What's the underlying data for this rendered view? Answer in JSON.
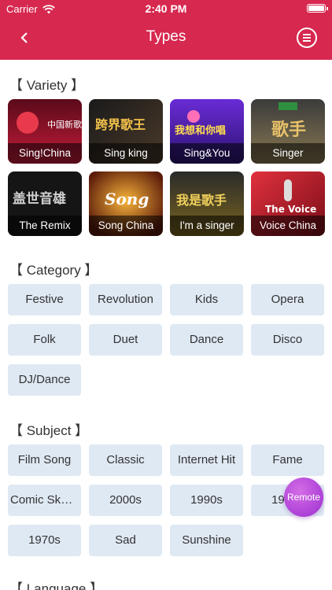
{
  "status": {
    "carrier": "Carrier",
    "time": "2:40 PM"
  },
  "nav": {
    "title": "Types"
  },
  "variety": {
    "title": "【 Variety 】",
    "items": [
      {
        "label": "Sing!China",
        "art": "中国新歌声"
      },
      {
        "label": "Sing king",
        "art": "跨界歌王"
      },
      {
        "label": "Sing&You",
        "art": "我想和你唱"
      },
      {
        "label": "Singer",
        "art": "歌手"
      },
      {
        "label": "The Remix",
        "art": "盖世音雄"
      },
      {
        "label": "Song China",
        "art": "Song"
      },
      {
        "label": "I'm a singer",
        "art": "我是歌手"
      },
      {
        "label": "Voice China",
        "art": "The Voice"
      }
    ]
  },
  "category": {
    "title": "【 Category 】",
    "items": [
      "Festive",
      "Revolution",
      "Kids",
      "Opera",
      "Folk",
      "Duet",
      "Dance",
      "Disco",
      "DJ/Dance"
    ]
  },
  "subject": {
    "title": "【 Subject 】",
    "items": [
      "Film Song",
      "Classic",
      "Internet Hit",
      "Fame",
      "Comic Sket...",
      "2000s",
      "1990s",
      "1980s",
      "1970s",
      "Sad",
      "Sunshine"
    ]
  },
  "language": {
    "title": "【 Language 】"
  },
  "remote": {
    "label": "Remote"
  },
  "colors": {
    "accent": "#d7284f",
    "chip": "#dfe9f3",
    "remote": "#b04ad8"
  },
  "icons": {
    "back": "chevron-left-icon",
    "menu": "menu-circle-icon",
    "wifi": "wifi-icon",
    "battery": "battery-icon"
  }
}
